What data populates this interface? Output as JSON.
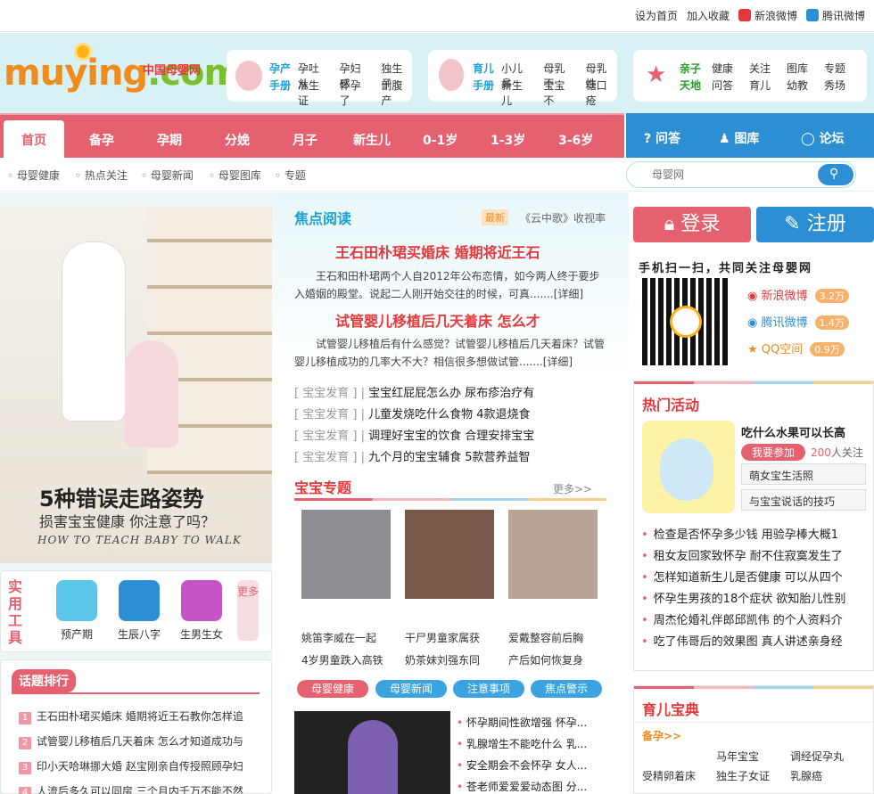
{
  "topbar": {
    "set_home": "设为首页",
    "bookmark": "加入收藏",
    "weibo": "新浪微博",
    "tencent": "腾讯微博"
  },
  "logo": {
    "en1": "muyi",
    "en2": "ng",
    "dot": ".com",
    "cn": "中国母婴网"
  },
  "header_boxes": [
    {
      "big1": "孕产",
      "big2": "手册",
      "row1": [
        "孕吐从",
        "孕妇感",
        "独生子"
      ],
      "row2": [
        "准生证",
        "怀孕了",
        "剖腹产"
      ]
    },
    {
      "big1": "育儿",
      "big2": "手册",
      "row1": [
        "小儿鼻",
        "母乳不",
        "母乳性"
      ],
      "row2": [
        "新生儿",
        "宝宝不",
        "糖口疮"
      ]
    },
    {
      "big1": "亲子",
      "big2": "天地",
      "row1": [
        "健康",
        "关注",
        "图库",
        "专题"
      ],
      "row2": [
        "问答",
        "育儿",
        "幼教",
        "秀场"
      ]
    }
  ],
  "nav": {
    "home": "首页",
    "tabs": [
      "备孕",
      "孕期",
      "分娩",
      "月子",
      "新生儿",
      "0-1岁",
      "1-3岁",
      "3-6岁"
    ],
    "right": [
      "问答",
      "图库",
      "论坛"
    ]
  },
  "subnav": [
    "母婴健康",
    "热点关注",
    "母婴新闻",
    "母婴图库",
    "专题"
  ],
  "search": {
    "placeholder": "母婴网"
  },
  "hero": {
    "title": "5种错误走路姿势",
    "subtitle": "损害宝宝健康 你注意了吗？",
    "en": "HOW TO TEACH BABY TO WALK"
  },
  "tools": {
    "label": "实用工具",
    "items": [
      "预产期",
      "生辰八字",
      "生男生女"
    ],
    "more": "更多"
  },
  "rank": {
    "title": "话题排行",
    "items": [
      "王石田朴珺买婚床 婚期将近王石教你怎样追",
      "试管婴儿移植后几天着床 怎么才知道成功与",
      "印小天哈琳挪大婚 赵宝刚亲自传授照顾孕妇",
      "人流后多久可以同房 三个月内千万不能不然"
    ]
  },
  "focus": {
    "title": "焦点阅读",
    "badge": "最新",
    "tag": "《云中歌》收视率",
    "h1": "王石田朴珺买婚床 婚期将近王石",
    "p1": "王石和田朴珺两个人自2012年公布恋情，如今两人终于要步入婚姻的殿堂。说起二人刚开始交往的时候，可真.......[详细]",
    "h2": "试管婴儿移植后几天着床 怎么才",
    "p2": "试管婴儿移植后有什么感觉？试管婴儿移植后几天着床？试管婴儿移植成功的几率大不大？相信很多想做试管.......[详细]",
    "list": [
      {
        "cat": "宝宝发育",
        "t": "宝宝红屁屁怎么办 尿布疹治疗有"
      },
      {
        "cat": "宝宝发育",
        "t": "儿童发烧吃什么食物 4款退烧食"
      },
      {
        "cat": "宝宝发育",
        "t": "调理好宝宝的饮食 合理安排宝宝"
      },
      {
        "cat": "宝宝发育",
        "t": "九个月的宝宝辅食 5款营养益智"
      }
    ]
  },
  "special": {
    "title": "宝宝专题",
    "more": "更多>>",
    "caps1": [
      "姚笛李威在一起",
      "干尸男童家属获",
      "爱戴整容前后胸"
    ],
    "caps2": [
      "4岁男童跌入高铁",
      "奶茶妹刘强东同",
      "产后如何恢复身"
    ]
  },
  "pills": [
    "母婴健康",
    "母婴新闻",
    "注意事项",
    "焦点警示"
  ],
  "bottom_list": [
    "怀孕期间性欲增强 怀孕...",
    "乳腺增生不能吃什么 乳...",
    "安全期会不会怀孕 女人...",
    "苍老师爱爱爱动态图 分..."
  ],
  "auth": {
    "login": "登录",
    "register": "注册"
  },
  "scan": "手机扫一扫，共同关注母婴网",
  "social": [
    {
      "name": "新浪微博",
      "count": "3.2万"
    },
    {
      "name": "腾讯微博",
      "count": "1.4万"
    },
    {
      "name": "QQ空间",
      "count": "0.9万"
    }
  ],
  "hot": {
    "title": "热门活动",
    "q": "吃什么水果可以长高",
    "join": "我要参加",
    "count": "200",
    "count_label": "人关注",
    "tags": [
      "萌女宝生活照",
      "与宝宝说话的技巧"
    ],
    "list": [
      "检查是否怀孕多少钱 用验孕棒大概1",
      "租女友回家致怀孕 耐不住寂寞发生了",
      "怎样知道新生儿是否健康 可以从四个",
      "怀孕生男孩的18个症状 欲知胎儿性别",
      "周杰伦婚礼伴郎邱凯伟 的个人资料介",
      "吃了伟哥后的效果图 真人讲述亲身经"
    ]
  },
  "bao": {
    "title": "育儿宝典",
    "sub": "备孕>>",
    "r1": [
      "马年宝宝",
      "调经促孕丸"
    ],
    "r2": [
      "受精卵着床",
      "独生子女证",
      "乳腺癌"
    ]
  },
  "colors": {
    "pink": "#e5616f",
    "blue": "#2d8fd3",
    "red": "#e5383b"
  }
}
